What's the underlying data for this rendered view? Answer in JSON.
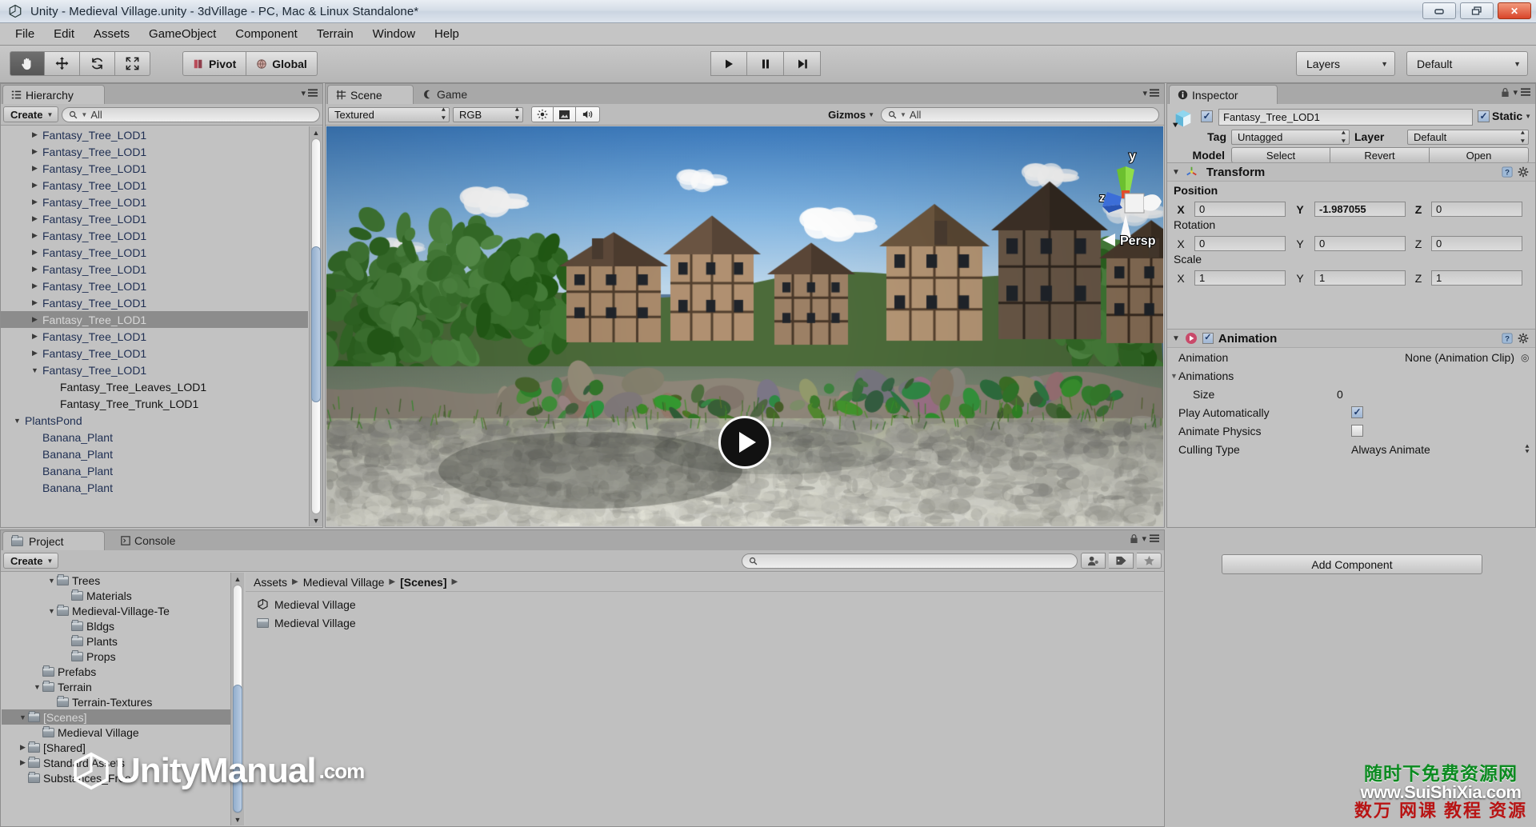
{
  "window": {
    "title": "Unity - Medieval Village.unity - 3dVillage - PC, Mac & Linux Standalone*",
    "minimize_label": "–",
    "maximize_label": "❐",
    "close_label": "✕"
  },
  "menu": {
    "items": [
      "File",
      "Edit",
      "Assets",
      "GameObject",
      "Component",
      "Terrain",
      "Window",
      "Help"
    ]
  },
  "toolbar": {
    "tools": [
      "hand-tool",
      "move-tool",
      "rotate-tool",
      "scale-tool"
    ],
    "pivot_label": "Pivot",
    "global_label": "Global",
    "play_label": "▶",
    "pause_label": "‖",
    "step_label": "▶|",
    "layers_label": "Layers",
    "layout_label": "Default"
  },
  "hierarchy": {
    "tab_label": "Hierarchy",
    "create_label": "Create",
    "search_placeholder": "All",
    "items": [
      {
        "label": "Fantasy_Tree_LOD1",
        "indent": 1,
        "arrow": "collapsed",
        "selected": false,
        "child": false
      },
      {
        "label": "Fantasy_Tree_LOD1",
        "indent": 1,
        "arrow": "collapsed",
        "selected": false,
        "child": false
      },
      {
        "label": "Fantasy_Tree_LOD1",
        "indent": 1,
        "arrow": "collapsed",
        "selected": false,
        "child": false
      },
      {
        "label": "Fantasy_Tree_LOD1",
        "indent": 1,
        "arrow": "collapsed",
        "selected": false,
        "child": false
      },
      {
        "label": "Fantasy_Tree_LOD1",
        "indent": 1,
        "arrow": "collapsed",
        "selected": false,
        "child": false
      },
      {
        "label": "Fantasy_Tree_LOD1",
        "indent": 1,
        "arrow": "collapsed",
        "selected": false,
        "child": false
      },
      {
        "label": "Fantasy_Tree_LOD1",
        "indent": 1,
        "arrow": "collapsed",
        "selected": false,
        "child": false
      },
      {
        "label": "Fantasy_Tree_LOD1",
        "indent": 1,
        "arrow": "collapsed",
        "selected": false,
        "child": false
      },
      {
        "label": "Fantasy_Tree_LOD1",
        "indent": 1,
        "arrow": "collapsed",
        "selected": false,
        "child": false
      },
      {
        "label": "Fantasy_Tree_LOD1",
        "indent": 1,
        "arrow": "collapsed",
        "selected": false,
        "child": false
      },
      {
        "label": "Fantasy_Tree_LOD1",
        "indent": 1,
        "arrow": "collapsed",
        "selected": false,
        "child": false
      },
      {
        "label": "Fantasy_Tree_LOD1",
        "indent": 1,
        "arrow": "collapsed",
        "selected": true,
        "child": false
      },
      {
        "label": "Fantasy_Tree_LOD1",
        "indent": 1,
        "arrow": "collapsed",
        "selected": false,
        "child": false
      },
      {
        "label": "Fantasy_Tree_LOD1",
        "indent": 1,
        "arrow": "collapsed",
        "selected": false,
        "child": false
      },
      {
        "label": "Fantasy_Tree_LOD1",
        "indent": 1,
        "arrow": "expanded",
        "selected": false,
        "child": false
      },
      {
        "label": "Fantasy_Tree_Leaves_LOD1",
        "indent": 2,
        "arrow": "none",
        "selected": false,
        "child": true
      },
      {
        "label": "Fantasy_Tree_Trunk_LOD1",
        "indent": 2,
        "arrow": "none",
        "selected": false,
        "child": true
      },
      {
        "label": "PlantsPond",
        "indent": 0,
        "arrow": "expanded",
        "selected": false,
        "child": false
      },
      {
        "label": "Banana_Plant",
        "indent": 1,
        "arrow": "none",
        "selected": false,
        "child": false
      },
      {
        "label": "Banana_Plant",
        "indent": 1,
        "arrow": "none",
        "selected": false,
        "child": false
      },
      {
        "label": "Banana_Plant",
        "indent": 1,
        "arrow": "none",
        "selected": false,
        "child": false
      },
      {
        "label": "Banana_Plant",
        "indent": 1,
        "arrow": "none",
        "selected": false,
        "child": false
      }
    ]
  },
  "scene": {
    "tab_scene": "Scene",
    "tab_game": "Game",
    "draw_mode": "Textured",
    "color_mode": "RGB",
    "gizmos_label": "Gizmos",
    "search_placeholder": "All",
    "persp_label": "Persp",
    "axis_y": "y",
    "axis_z": "z",
    "video_play_label": "▶"
  },
  "inspector": {
    "tab_label": "Inspector",
    "object_name": "Fantasy_Tree_LOD1",
    "static_label": "Static",
    "static_checked": true,
    "enabled_checked": true,
    "tag_label": "Tag",
    "tag_value": "Untagged",
    "layer_label": "Layer",
    "layer_value": "Default",
    "model_label": "Model",
    "model_buttons": [
      "Select",
      "Revert",
      "Open"
    ],
    "transform": {
      "title": "Transform",
      "position_label": "Position",
      "rotation_label": "Rotation",
      "scale_label": "Scale",
      "axes": [
        "X",
        "Y",
        "Z"
      ],
      "position": [
        "0",
        "-1.987055",
        "0"
      ],
      "rotation": [
        "0",
        "0",
        "0"
      ],
      "scale": [
        "1",
        "1",
        "1"
      ]
    },
    "animation": {
      "title": "Animation",
      "enabled_checked": true,
      "rows": [
        {
          "label": "Animation",
          "value": "None (Animation Clip)",
          "type": "object"
        },
        {
          "label": "Animations",
          "value": "",
          "type": "foldout"
        },
        {
          "label": "Size",
          "value": "0",
          "type": "text"
        },
        {
          "label": "Play Automatically",
          "value": "",
          "type": "checkbox",
          "checked": true
        },
        {
          "label": "Animate Physics",
          "value": "",
          "type": "checkbox",
          "checked": false
        },
        {
          "label": "Culling Type",
          "value": "Always Animate",
          "type": "popup"
        }
      ]
    },
    "add_component_label": "Add Component"
  },
  "project": {
    "tab_project": "Project",
    "tab_console": "Console",
    "create_label": "Create",
    "search_placeholder": "",
    "breadcrumb": [
      "Assets",
      "Medieval Village",
      "[Scenes]"
    ],
    "tree": [
      {
        "label": "Trees",
        "indent": 3,
        "arrow": "expanded",
        "selected": false
      },
      {
        "label": "Materials",
        "indent": 4,
        "arrow": "none",
        "selected": false
      },
      {
        "label": "Medieval-Village-Te",
        "indent": 3,
        "arrow": "expanded",
        "selected": false
      },
      {
        "label": "Bldgs",
        "indent": 4,
        "arrow": "none",
        "selected": false
      },
      {
        "label": "Plants",
        "indent": 4,
        "arrow": "none",
        "selected": false
      },
      {
        "label": "Props",
        "indent": 4,
        "arrow": "none",
        "selected": false
      },
      {
        "label": "Prefabs",
        "indent": 2,
        "arrow": "none",
        "selected": false
      },
      {
        "label": "Terrain",
        "indent": 2,
        "arrow": "expanded",
        "selected": false
      },
      {
        "label": "Terrain-Textures",
        "indent": 3,
        "arrow": "none",
        "selected": false
      },
      {
        "label": "[Scenes]",
        "indent": 1,
        "arrow": "expanded",
        "selected": true
      },
      {
        "label": "Medieval Village",
        "indent": 2,
        "arrow": "none",
        "selected": false
      },
      {
        "label": "[Shared]",
        "indent": 1,
        "arrow": "collapsed",
        "selected": false
      },
      {
        "label": "Standard Assets",
        "indent": 1,
        "arrow": "collapsed",
        "selected": false
      },
      {
        "label": "Substances_Free",
        "indent": 1,
        "arrow": "none",
        "selected": false
      }
    ],
    "files": [
      {
        "label": "Medieval Village",
        "icon": "unity-scene-icon"
      },
      {
        "label": "Medieval Village",
        "icon": "folder-icon"
      }
    ]
  },
  "watermarks": {
    "unity_manual": "UnityManual",
    "unity_manual_tld": ".com",
    "cn_line1": "随时下免费资源网",
    "cn_line2": "www.SuiShiXia.com",
    "cn_line3": "数万 网课 教程 资源"
  },
  "colors": {
    "chrome": "#c2c2c2",
    "selection": "#8c8c8c",
    "hierarchy_text": "#1e2e52",
    "accent_close": "#d9452a"
  }
}
